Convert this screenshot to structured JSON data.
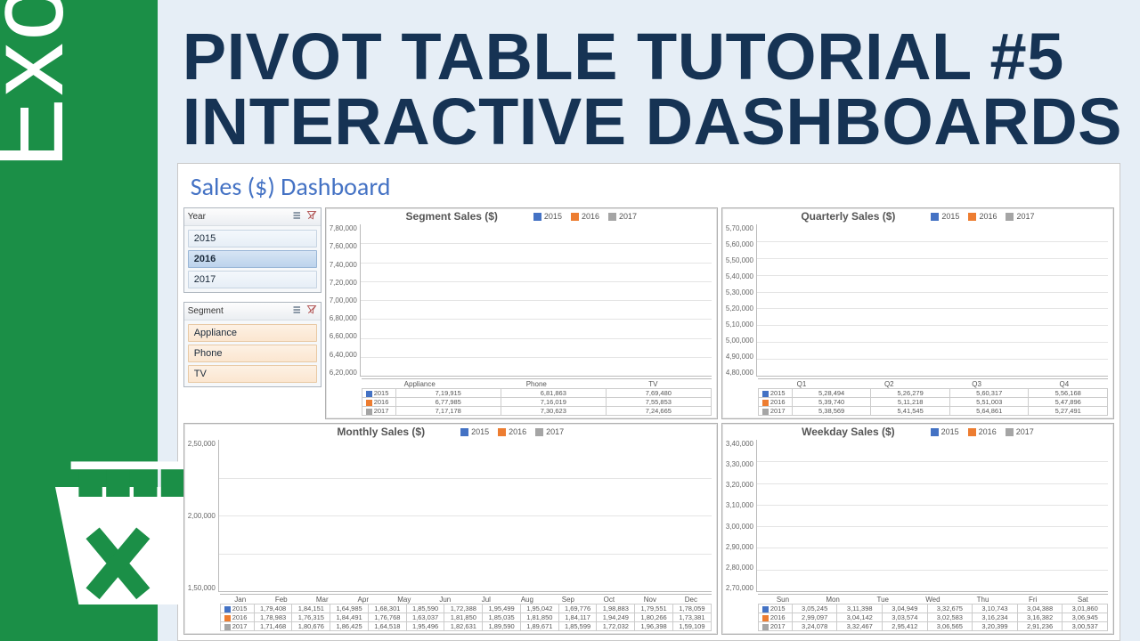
{
  "rail": {
    "label": "Excel"
  },
  "headline": {
    "line1": "PIVOT TABLE TUTORIAL #5",
    "line2": "INTERACTIVE DASHBOARDS"
  },
  "dashboard": {
    "title": "Sales ($) Dashboard",
    "series_colors": {
      "2015": "#4472c4",
      "2016": "#ed7d31",
      "2017": "#a5a5a5"
    },
    "slicers": {
      "year": {
        "title": "Year",
        "items": [
          "2015",
          "2016",
          "2017"
        ]
      },
      "segment": {
        "title": "Segment",
        "items": [
          "Appliance",
          "Phone",
          "TV"
        ]
      }
    }
  },
  "chart_data": [
    {
      "id": "segment",
      "type": "bar",
      "title": "Segment Sales ($)",
      "categories": [
        "Appliance",
        "Phone",
        "TV"
      ],
      "series": [
        {
          "name": "2015",
          "values": [
            719915,
            681863,
            769480
          ]
        },
        {
          "name": "2016",
          "values": [
            677985,
            716019,
            755853
          ]
        },
        {
          "name": "2017",
          "values": [
            717178,
            730623,
            724665
          ]
        }
      ],
      "ylim": [
        620000,
        780000
      ],
      "yticks": [
        "7,80,000",
        "7,60,000",
        "7,40,000",
        "7,20,000",
        "7,00,000",
        "6,80,000",
        "6,60,000",
        "6,40,000",
        "6,20,000"
      ],
      "table": [
        [
          "7,19,915",
          "6,81,863",
          "7,69,480"
        ],
        [
          "6,77,985",
          "7,16,019",
          "7,55,853"
        ],
        [
          "7,17,178",
          "7,30,623",
          "7,24,665"
        ]
      ]
    },
    {
      "id": "quarterly",
      "type": "bar",
      "title": "Quarterly Sales ($)",
      "categories": [
        "Q1",
        "Q2",
        "Q3",
        "Q4"
      ],
      "series": [
        {
          "name": "2015",
          "values": [
            528494,
            526279,
            560317,
            556168
          ]
        },
        {
          "name": "2016",
          "values": [
            539740,
            511218,
            551003,
            547896
          ]
        },
        {
          "name": "2017",
          "values": [
            538569,
            541545,
            564861,
            527491
          ]
        }
      ],
      "ylim": [
        480000,
        570000
      ],
      "yticks": [
        "5,70,000",
        "5,60,000",
        "5,50,000",
        "5,40,000",
        "5,30,000",
        "5,20,000",
        "5,10,000",
        "5,00,000",
        "4,90,000",
        "4,80,000"
      ],
      "table": [
        [
          "5,28,494",
          "5,26,279",
          "5,60,317",
          "5,56,168"
        ],
        [
          "5,39,740",
          "5,11,218",
          "5,51,003",
          "5,47,896"
        ],
        [
          "5,38,569",
          "5,41,545",
          "5,64,861",
          "5,27,491"
        ]
      ]
    },
    {
      "id": "monthly",
      "type": "bar",
      "title": "Monthly Sales ($)",
      "categories": [
        "Jan",
        "Feb",
        "Mar",
        "Apr",
        "May",
        "Jun",
        "Jul",
        "Aug",
        "Sep",
        "Oct",
        "Nov",
        "Dec"
      ],
      "series": [
        {
          "name": "2015",
          "values": [
            179408,
            184151,
            164985,
            168301,
            185590,
            172388,
            195499,
            195042,
            169776,
            198883,
            179551,
            178059
          ]
        },
        {
          "name": "2016",
          "values": [
            178983,
            176315,
            184491,
            176768,
            163037,
            181850,
            185035,
            181850,
            184117,
            194249,
            180266,
            173381
          ]
        },
        {
          "name": "2017",
          "values": [
            171468,
            180676,
            186425,
            164518,
            195496,
            182631,
            189590,
            189671,
            185599,
            172032,
            196398,
            159109
          ]
        }
      ],
      "ylim": [
        150000,
        250000
      ],
      "yticks": [
        "2,50,000",
        "",
        "2,00,000",
        "",
        "1,50,000"
      ],
      "table": [
        [
          "1,79,408",
          "1,84,151",
          "1,64,985",
          "1,68,301",
          "1,85,590",
          "1,72,388",
          "1,95,499",
          "1,95,042",
          "1,69,776",
          "1,98,883",
          "1,79,551",
          "1,78,059"
        ],
        [
          "1,78,983",
          "1,76,315",
          "1,84,491",
          "1,76,768",
          "1,63,037",
          "1,81,850",
          "1,85,035",
          "1,81,850",
          "1,84,117",
          "1,94,249",
          "1,80,266",
          "1,73,381"
        ],
        [
          "1,71,468",
          "1,80,676",
          "1,86,425",
          "1,64,518",
          "1,95,496",
          "1,82,631",
          "1,89,590",
          "1,89,671",
          "1,85,599",
          "1,72,032",
          "1,96,398",
          "1,59,109"
        ]
      ]
    },
    {
      "id": "weekday",
      "type": "bar",
      "title": "Weekday Sales ($)",
      "categories": [
        "Sun",
        "Mon",
        "Tue",
        "Wed",
        "Thu",
        "Fri",
        "Sat"
      ],
      "series": [
        {
          "name": "2015",
          "values": [
            305245,
            311398,
            304949,
            332675,
            310743,
            304388,
            301860
          ]
        },
        {
          "name": "2016",
          "values": [
            299097,
            304142,
            303574,
            302583,
            316234,
            316382,
            306945
          ]
        },
        {
          "name": "2017",
          "values": [
            324078,
            332467,
            295412,
            306565,
            320399,
            291236,
            300537
          ]
        }
      ],
      "ylim": [
        270000,
        340000
      ],
      "yticks": [
        "3,40,000",
        "3,30,000",
        "3,20,000",
        "3,10,000",
        "3,00,000",
        "2,90,000",
        "2,80,000",
        "2,70,000"
      ],
      "table": [
        [
          "3,05,245",
          "3,11,398",
          "3,04,949",
          "3,32,675",
          "3,10,743",
          "3,04,388",
          "3,01,860"
        ],
        [
          "2,99,097",
          "3,04,142",
          "3,03,574",
          "3,02,583",
          "3,16,234",
          "3,16,382",
          "3,06,945"
        ],
        [
          "3,24,078",
          "3,32,467",
          "2,95,412",
          "3,06,565",
          "3,20,399",
          "2,91,236",
          "3,00,537"
        ]
      ]
    }
  ]
}
